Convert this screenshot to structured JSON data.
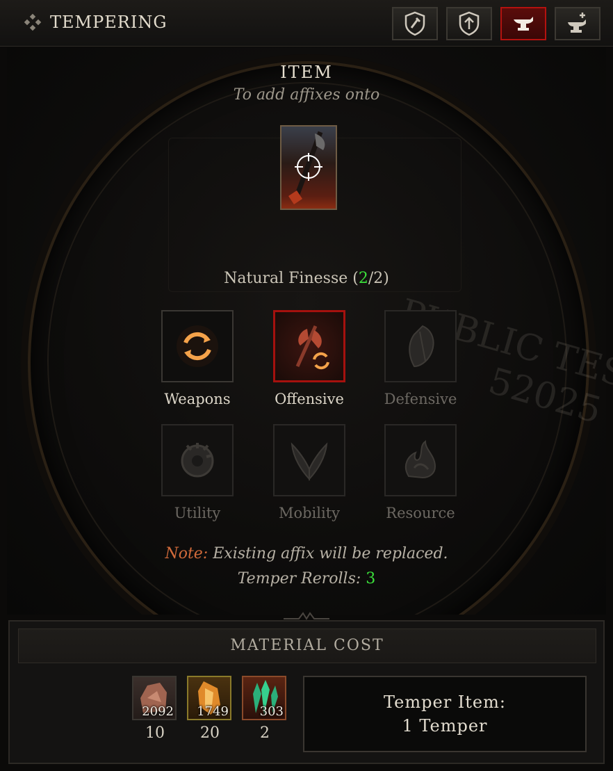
{
  "header": {
    "title": "TEMPERING",
    "tabs": [
      {
        "name": "tab-salvage",
        "icon": "shield-hammer-icon"
      },
      {
        "name": "tab-upgrade",
        "icon": "shield-upgrade-icon"
      },
      {
        "name": "tab-temper",
        "icon": "anvil-icon",
        "active": true
      },
      {
        "name": "tab-masterwork",
        "icon": "anvil-plus-icon"
      }
    ]
  },
  "item": {
    "title": "ITEM",
    "subtitle": "To add affixes onto"
  },
  "affix": {
    "name": "Natural Finesse",
    "open": "(",
    "current": "2",
    "rest": "/2)"
  },
  "categories": [
    {
      "label": "Weapons",
      "state": "available"
    },
    {
      "label": "Offensive",
      "state": "selected"
    },
    {
      "label": "Defensive",
      "state": "disabled"
    },
    {
      "label": "Utility",
      "state": "disabled"
    },
    {
      "label": "Mobility",
      "state": "disabled"
    },
    {
      "label": "Resource",
      "state": "disabled"
    }
  ],
  "note": {
    "label": "Note:",
    "text": " Existing affix will be replaced."
  },
  "rerolls": {
    "label": "Temper Rerolls: ",
    "value": "3"
  },
  "watermark": {
    "line1": "PUBLIC TES",
    "line2": "52025"
  },
  "material_cost": {
    "title": "MATERIAL COST",
    "materials": [
      {
        "icon": "iron-chunk-icon",
        "owned": "2092",
        "required": "10"
      },
      {
        "icon": "ember-shard-icon",
        "owned": "1749",
        "required": "20"
      },
      {
        "icon": "veiled-crystal-icon",
        "owned": "303",
        "required": "2"
      }
    ]
  },
  "action": {
    "line1": "Temper Item:",
    "line2": "1 Temper"
  },
  "colors": {
    "accent_red": "#a5110e",
    "highlight_green": "#3be03b",
    "note_orange": "#d06a3a"
  }
}
